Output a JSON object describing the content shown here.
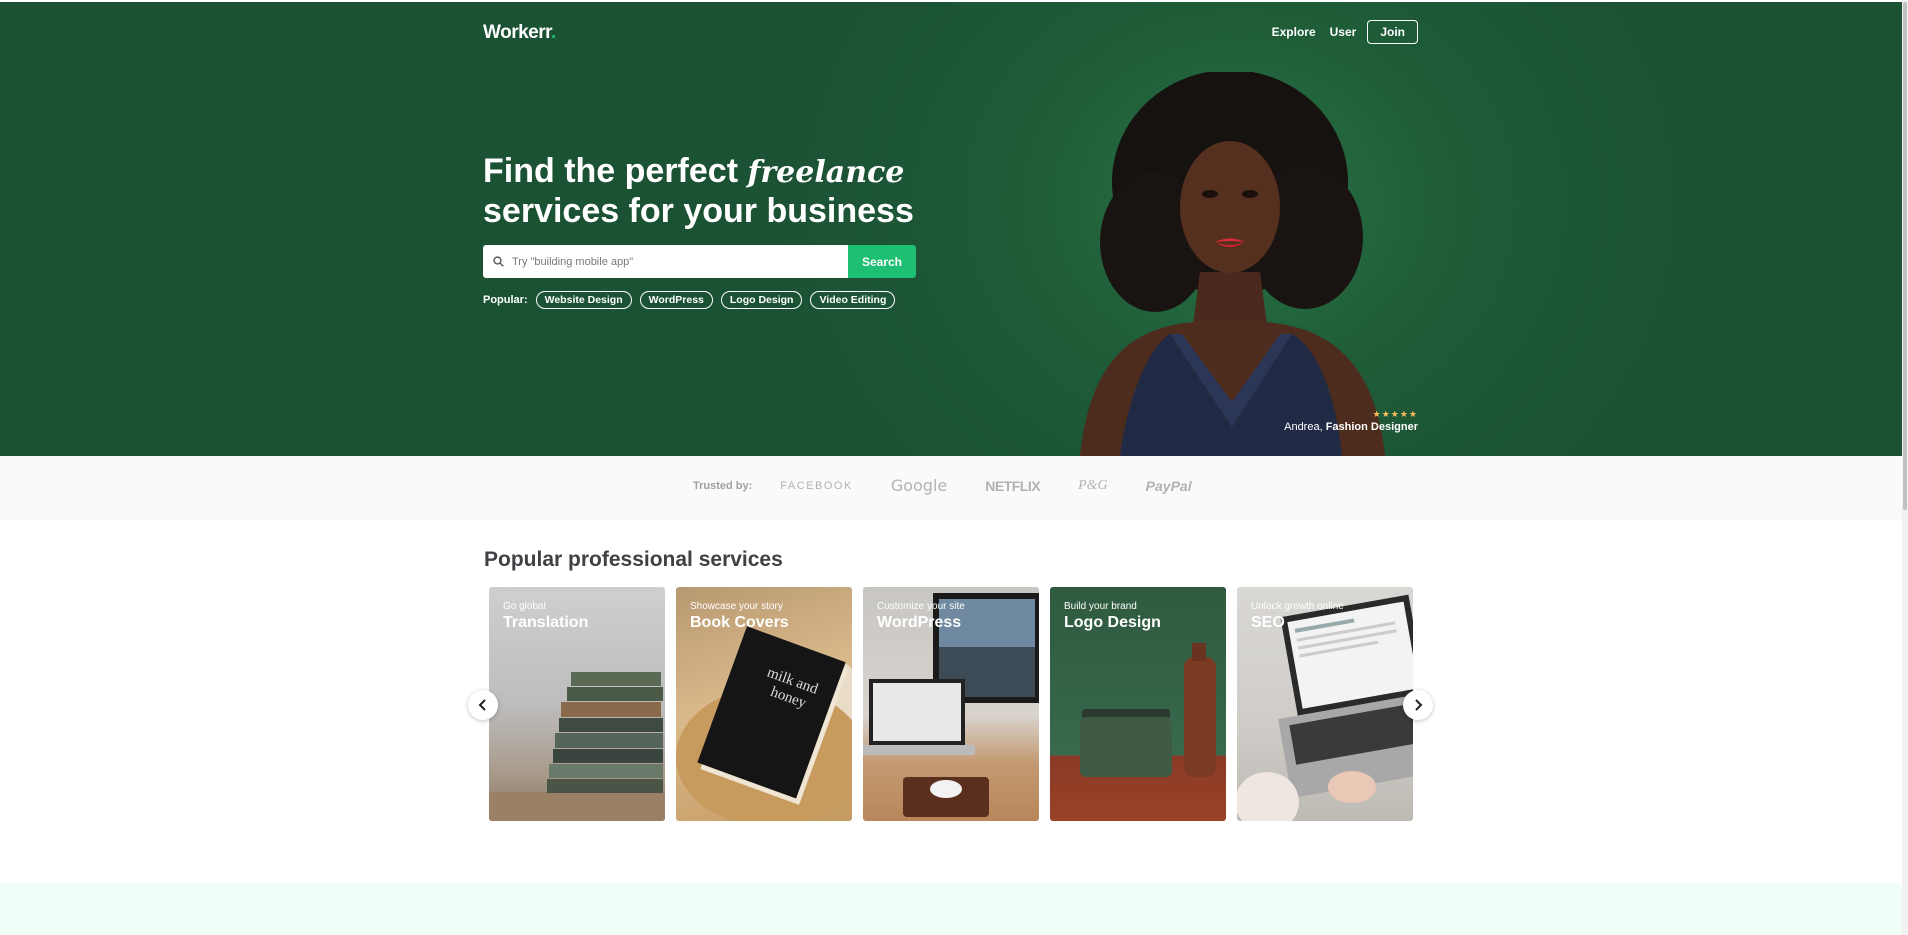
{
  "nav": {
    "logo": "Workerr",
    "logo_dot": ".",
    "links": [
      "Explore",
      "User"
    ],
    "join_label": "Join"
  },
  "hero": {
    "title_line1": "Find the perfect ",
    "title_em": "freelance",
    "title_line2": "services for your business",
    "search_placeholder": "Try \"building mobile app\"",
    "search_button": "Search",
    "popular_label": "Popular:",
    "popular_tags": [
      "Website Design",
      "WordPress",
      "Logo Design",
      "Video Editing"
    ],
    "rating": "★★★★★",
    "credit_name": "Andrea, ",
    "credit_role": "Fashion Designer"
  },
  "trusted": {
    "label": "Trusted by:",
    "brands": [
      "FACEBOOK",
      "Google",
      "NETFLIX",
      "P&G",
      "PayPal"
    ]
  },
  "services": {
    "title": "Popular professional services",
    "cards": [
      {
        "sub": "Go global",
        "name": "Translation"
      },
      {
        "sub": "Showcase your story",
        "name": "Book Covers"
      },
      {
        "sub": "Customize your site",
        "name": "WordPress"
      },
      {
        "sub": "Build your brand",
        "name": "Logo Design"
      },
      {
        "sub": "Unlock growth online",
        "name": "SEO"
      }
    ]
  },
  "colors": {
    "hero_green": "#1d5636",
    "accent": "#1dbf73",
    "star": "#ffbe5b"
  }
}
